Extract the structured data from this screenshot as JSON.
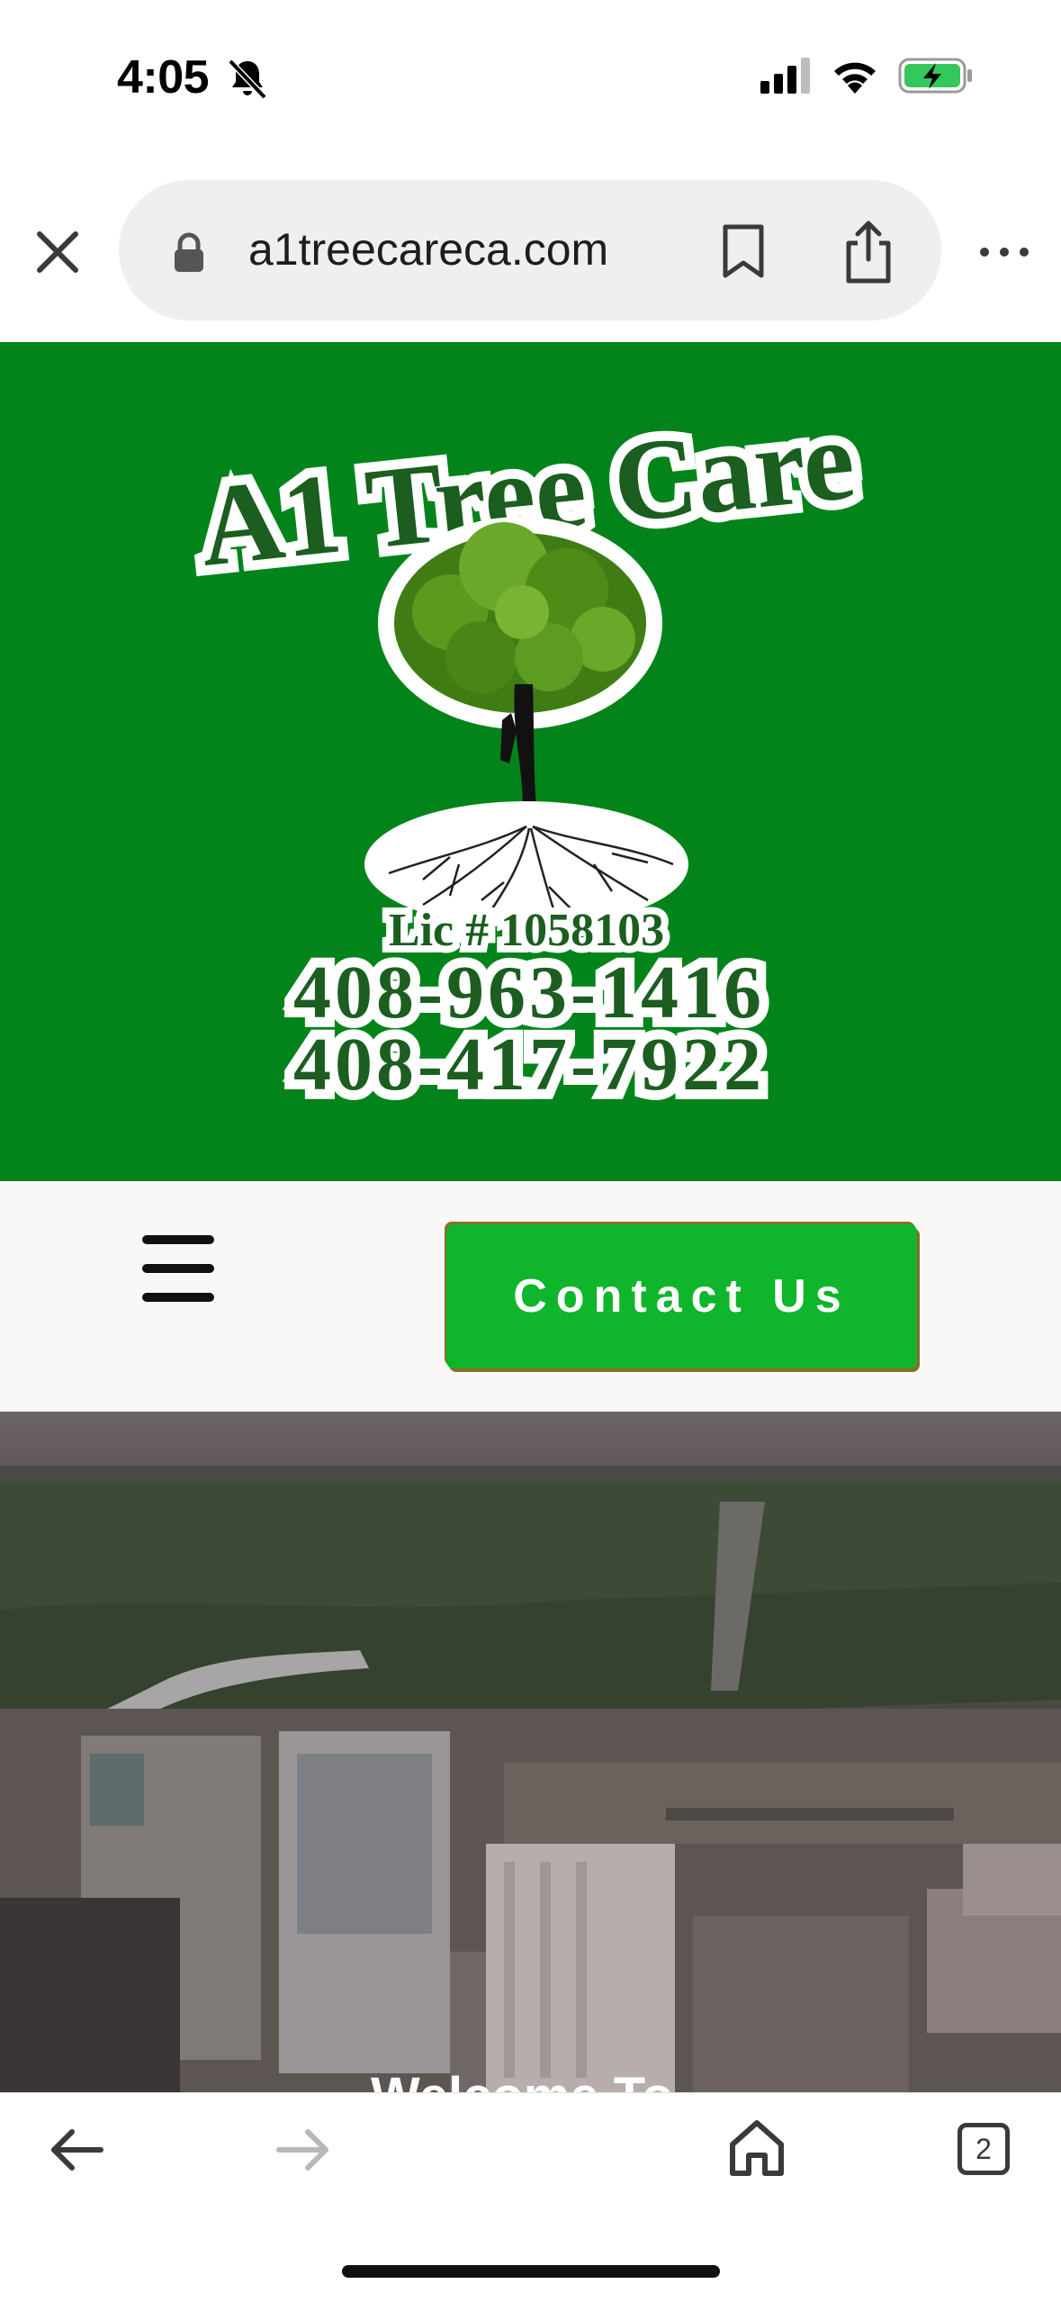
{
  "status_bar": {
    "time": "4:05"
  },
  "browser": {
    "url": "a1treecareca.com",
    "tab_count": "2"
  },
  "logo": {
    "title": "A1 Tree Care",
    "license": "Lic # 1058103",
    "phone_1": "408-963-1416",
    "phone_2": "408-417-7922"
  },
  "nav": {
    "contact_label": "Contact Us"
  },
  "hero": {
    "heading_partial": "Welcome To"
  },
  "colors": {
    "header_green": "#02841b",
    "button_green": "#0fb52b",
    "logo_text_green": "#1b5e20"
  },
  "icons": [
    "bell-slash-icon",
    "signal-icon",
    "wifi-icon",
    "battery-charging-icon",
    "close-icon",
    "lock-icon",
    "bookmark-icon",
    "share-icon",
    "more-icon",
    "menu-icon",
    "back-arrow-icon",
    "forward-arrow-icon",
    "home-icon",
    "tabs-icon"
  ]
}
